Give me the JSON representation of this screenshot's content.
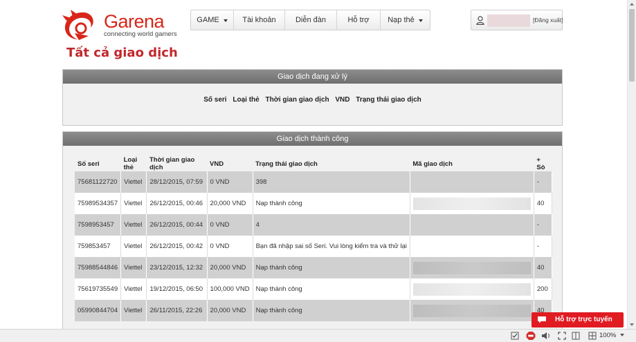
{
  "logo": {
    "brand": "Garena",
    "tagline": "connecting world gamers"
  },
  "nav": [
    {
      "label": "GAME",
      "has_caret": true
    },
    {
      "label": "Tài khoản",
      "has_caret": false
    },
    {
      "label": "Diễn đàn",
      "has_caret": false
    },
    {
      "label": "Hỗ trợ",
      "has_caret": false
    },
    {
      "label": "Nạp thẻ",
      "has_caret": true
    }
  ],
  "user": {
    "icon": "user-icon",
    "logout_label": "[Đăng xuất]"
  },
  "page_title": "Tất cả giao dịch",
  "pending": {
    "title": "Giao dịch đang xử lý",
    "headers": [
      "Số seri",
      "Loại thẻ",
      "Thời gian giao dịch",
      "VND",
      "Trạng thái giao dịch"
    ]
  },
  "success": {
    "title": "Giao dịch thành công",
    "headers": [
      "Số seri",
      "Loại thẻ",
      "Thời gian giao dịch",
      "VND",
      "Trạng thái giao dịch",
      "Mã giao dịch",
      "+ Sò"
    ],
    "rows": [
      {
        "seri": "75681122720",
        "type": "Viettel",
        "time": "28/12/2015, 07:59",
        "vnd": "0 VND",
        "status": "398",
        "so": "-"
      },
      {
        "seri": "75989534357",
        "type": "Viettel",
        "time": "26/12/2015, 00:46",
        "vnd": "20,000 VND",
        "status": "Nạp thành công",
        "so": "40"
      },
      {
        "seri": "7598953457",
        "type": "Viettel",
        "time": "26/12/2015, 00:44",
        "vnd": "0 VND",
        "status": "4",
        "so": "-"
      },
      {
        "seri": "759853457",
        "type": "Viettel",
        "time": "26/12/2015, 00:42",
        "vnd": "0 VND",
        "status": "Bạn đã nhập sai số Seri. Vui lòng kiểm tra và thử lại",
        "so": "-"
      },
      {
        "seri": "75988544846",
        "type": "Viettel",
        "time": "23/12/2015, 12:32",
        "vnd": "20,000 VND",
        "status": "Nạp thành công",
        "so": "40"
      },
      {
        "seri": "75619735549",
        "type": "Viettel",
        "time": "19/12/2015, 06:50",
        "vnd": "100,000 VND",
        "status": "Nạp thành công",
        "so": "200"
      },
      {
        "seri": "05990844704",
        "type": "Viettel",
        "time": "26/11/2015, 22:26",
        "vnd": "20,000 VND",
        "status": "Nạp thành công",
        "so": "40"
      }
    ]
  },
  "support_button": "Hỗ trợ trực tuyến",
  "status_bar": {
    "zoom": "100%"
  },
  "colors": {
    "brand_red": "#d7261a",
    "title_red": "#c1272d",
    "panel_header": "#7a7a7a",
    "row_gray": "#d0d0d0",
    "support_red": "#e01b22"
  }
}
